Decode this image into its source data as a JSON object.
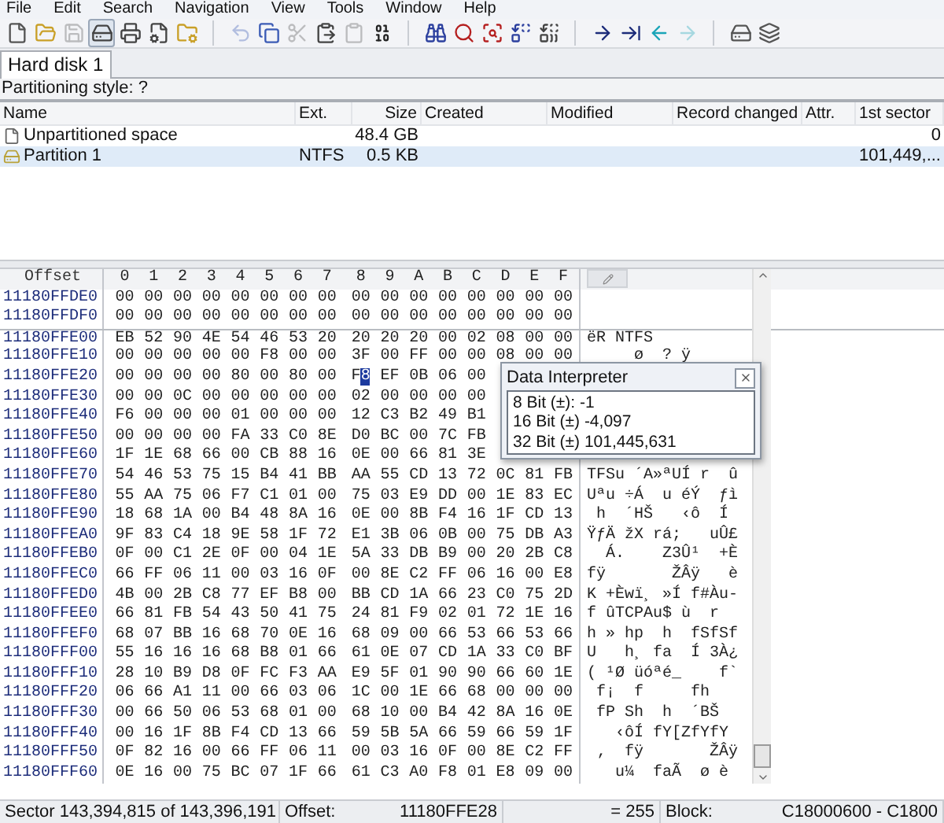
{
  "menu": [
    "File",
    "Edit",
    "Search",
    "Navigation",
    "View",
    "Tools",
    "Window",
    "Help"
  ],
  "toolbar": [
    {
      "kind": "new",
      "disabled": false
    },
    {
      "kind": "open",
      "disabled": false
    },
    {
      "kind": "save",
      "disabled": true
    },
    {
      "kind": "disk",
      "disabled": false,
      "pressed": true
    },
    {
      "kind": "print",
      "disabled": false
    },
    {
      "kind": "properties",
      "disabled": false
    },
    {
      "kind": "folder",
      "disabled": false
    },
    {
      "kind": "sep"
    },
    {
      "kind": "undo",
      "disabled": true
    },
    {
      "kind": "copy",
      "disabled": false
    },
    {
      "kind": "cut",
      "disabled": true
    },
    {
      "kind": "paste",
      "disabled": false
    },
    {
      "kind": "paste2",
      "disabled": true
    },
    {
      "kind": "binary",
      "disabled": false
    },
    {
      "kind": "sep"
    },
    {
      "kind": "find",
      "disabled": false
    },
    {
      "kind": "findtext",
      "disabled": false
    },
    {
      "kind": "findhex",
      "disabled": false
    },
    {
      "kind": "replace",
      "disabled": false
    },
    {
      "kind": "replacehex",
      "disabled": false
    },
    {
      "kind": "sep"
    },
    {
      "kind": "goto",
      "disabled": false
    },
    {
      "kind": "gotoline",
      "disabled": false
    },
    {
      "kind": "back",
      "disabled": false
    },
    {
      "kind": "forward",
      "disabled": true
    },
    {
      "kind": "sep"
    },
    {
      "kind": "drive",
      "disabled": false
    },
    {
      "kind": "drives",
      "disabled": false
    }
  ],
  "tabs": [
    {
      "label": "Hard disk 1",
      "selected": true
    }
  ],
  "partitioning_style": "Partitioning style: ?",
  "table": {
    "columns": [
      "Name",
      "Ext.",
      "Size",
      "Created",
      "Modified",
      "Record changed",
      "Attr.",
      "1st sector"
    ],
    "rows": [
      {
        "kind": "space",
        "name": "Unpartitioned space",
        "size": "48.4 GB",
        "first_sector": "0",
        "selected": false
      },
      {
        "kind": "partition",
        "name": "Partition 1",
        "ext": "NTFS",
        "size": "0.5 KB",
        "first_sector": "101,449,...",
        "selected": true
      }
    ]
  },
  "hex": {
    "columns": [
      "Offset",
      "0",
      "1",
      "2",
      "3",
      "4",
      "5",
      "6",
      "7",
      "8",
      "9",
      "A",
      "B",
      "C",
      "D",
      "E",
      "F"
    ],
    "rows": [
      {
        "offset": "11180FFDE0",
        "bytes": "00 00 00 00 00 00 00 00 00 00 00 00 00 00 00 00",
        "sector_start": false
      },
      {
        "offset": "11180FFDF0",
        "bytes": "00 00 00 00 00 00 00 00 00 00 00 00 00 00 00 00",
        "sector_start": false
      },
      {
        "offset": "11180FFE00",
        "bytes": "EB 52 90 4E 54 46 53 20 20 20 20 00 02 08 00 00",
        "ascii": "ëR NTFS",
        "sector_start": true
      },
      {
        "offset": "11180FFE10",
        "bytes": "00 00 00 00 00 F8 00 00 3F 00 FF 00 00 08 00 00",
        "ascii": "     ø  ? ÿ",
        "sector_start": false
      },
      {
        "offset": "11180FFE20",
        "bytes": "00 00 00 00 80 00 80 00",
        "cursor_byte": "F8",
        "bytes_after": "EF 0B 06 00",
        "sector_start": false
      },
      {
        "offset": "11180FFE30",
        "bytes": "00 00 0C 00 00 00 00 00 02 00 00 00 00",
        "sector_start": false
      },
      {
        "offset": "11180FFE40",
        "bytes": "F6 00 00 00 01 00 00 00 12 C3 B2 49 B1",
        "sector_start": false
      },
      {
        "offset": "11180FFE50",
        "bytes": "00 00 00 00 FA 33 C0 8E D0 BC 00 7C FB",
        "sector_start": false
      },
      {
        "offset": "11180FFE60",
        "bytes": "1F 1E 68 66 00 CB 88 16 0E 00 66 81 3E",
        "sector_start": false
      },
      {
        "offset": "11180FFE70",
        "bytes": "54 46 53 75 15 B4 41 BB AA 55 CD 13 72 0C 81 FB",
        "ascii": "TFSu ´A»ªUÍ r  û",
        "sector_start": false
      },
      {
        "offset": "11180FFE80",
        "bytes": "55 AA 75 06 F7 C1 01 00 75 03 E9 DD 00 1E 83 EC",
        "ascii": "Uªu ÷Á  u éÝ  ƒì",
        "sector_start": false
      },
      {
        "offset": "11180FFE90",
        "bytes": "18 68 1A 00 B4 48 8A 16 0E 00 8B F4 16 1F CD 13",
        "ascii": " h  ´HŠ   ‹ô  Í",
        "sector_start": false
      },
      {
        "offset": "11180FFEA0",
        "bytes": "9F 83 C4 18 9E 58 1F 72 E1 3B 06 0B 00 75 DB A3",
        "ascii": "ŸƒÄ žX rá;   uÛ£",
        "sector_start": false
      },
      {
        "offset": "11180FFEB0",
        "bytes": "0F 00 C1 2E 0F 00 04 1E 5A 33 DB B9 00 20 2B C8",
        "ascii": "  Á.    Z3Û¹  +È",
        "sector_start": false
      },
      {
        "offset": "11180FFEC0",
        "bytes": "66 FF 06 11 00 03 16 0F 00 8E C2 FF 06 16 00 E8",
        "ascii": "fÿ       ŽÂÿ   è",
        "sector_start": false
      },
      {
        "offset": "11180FFED0",
        "bytes": "4B 00 2B C8 77 EF B8 00 BB CD 1A 66 23 C0 75 2D",
        "ascii": "K +Èwï¸ »Í f#Àu-",
        "sector_start": false
      },
      {
        "offset": "11180FFEE0",
        "bytes": "66 81 FB 54 43 50 41 75 24 81 F9 02 01 72 1E 16",
        "ascii": "f ûTCPAu$ ù  r",
        "sector_start": false
      },
      {
        "offset": "11180FFEF0",
        "bytes": "68 07 BB 16 68 70 0E 16 68 09 00 66 53 66 53 66",
        "ascii": "h » hp  h  fSfSf",
        "sector_start": false
      },
      {
        "offset": "11180FFF00",
        "bytes": "55 16 16 16 68 B8 01 66 61 0E 07 CD 1A 33 C0 BF",
        "ascii": "U   h¸ fa  Í 3À¿",
        "sector_start": false
      },
      {
        "offset": "11180FFF10",
        "bytes": "28 10 B9 D8 0F FC F3 AA E9 5F 01 90 90 66 60 1E",
        "ascii": "( ¹Ø üóªé_    f`",
        "sector_start": false
      },
      {
        "offset": "11180FFF20",
        "bytes": "06 66 A1 11 00 66 03 06 1C 00 1E 66 68 00 00 00",
        "ascii": " f¡  f     fh",
        "sector_start": false
      },
      {
        "offset": "11180FFF30",
        "bytes": "00 66 50 06 53 68 01 00 68 10 00 B4 42 8A 16 0E",
        "ascii": " fP Sh  h  ´BŠ",
        "sector_start": false
      },
      {
        "offset": "11180FFF40",
        "bytes": "00 16 1F 8B F4 CD 13 66 59 5B 5A 66 59 66 59 1F",
        "ascii": "   ‹ôÍ fY[ZfYfY",
        "sector_start": false
      },
      {
        "offset": "11180FFF50",
        "bytes": "0F 82 16 00 66 FF 06 11 00 03 16 0F 00 8E C2 FF",
        "ascii": " ‚  fÿ       ŽÂÿ",
        "sector_start": false
      },
      {
        "offset": "11180FFF60",
        "bytes": "0E 16 00 75 BC 07 1F 66 61 C3 A0 F8 01 E8 09 00",
        "ascii": "   u¼  faÃ  ø è",
        "sector_start": false
      }
    ]
  },
  "interpreter": {
    "title": "Data Interpreter",
    "lines": [
      "8 Bit (±): -1",
      "16 Bit (±) -4,097",
      "32 Bit (±) 101,445,631"
    ]
  },
  "status_bar": {
    "sector": "Sector 143,394,815 of 143,396,191",
    "offset_label": "Offset:",
    "offset": "11180FFE28",
    "value": "= 255",
    "block_label": "Block:",
    "block": "C18000600 - C1800"
  }
}
